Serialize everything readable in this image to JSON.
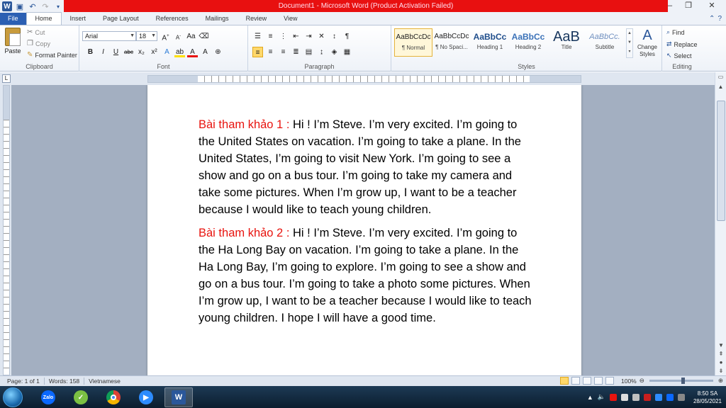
{
  "window": {
    "title": "Document1  -  Microsoft Word (Product Activation Failed)"
  },
  "ribbon_tabs": [
    "File",
    "Home",
    "Insert",
    "Page Layout",
    "References",
    "Mailings",
    "Review",
    "View"
  ],
  "clipboard": {
    "paste_label": "Paste",
    "cut_label": "Cut",
    "copy_label": "Copy",
    "format_painter_label": "Format Painter",
    "group_label": "Clipboard"
  },
  "font": {
    "name": "Arial",
    "size": "18",
    "group_label": "Font"
  },
  "paragraph": {
    "group_label": "Paragraph"
  },
  "styles": {
    "items": [
      {
        "preview": "AaBbCcDc",
        "name": "¶ Normal"
      },
      {
        "preview": "AaBbCcDc",
        "name": "¶ No Spaci..."
      },
      {
        "preview": "AaBbCc",
        "name": "Heading 1"
      },
      {
        "preview": "AaBbCc",
        "name": "Heading 2"
      },
      {
        "preview": "AaB",
        "name": "Title"
      },
      {
        "preview": "AaBbCc.",
        "name": "Subtitle"
      }
    ],
    "change_styles_label": "Change Styles",
    "group_label": "Styles"
  },
  "editing": {
    "find_label": "Find",
    "replace_label": "Replace",
    "select_label": "Select",
    "group_label": "Editing"
  },
  "document": {
    "paragraphs": [
      {
        "label": "Bài tham khảo 1 : ",
        "text": "Hi ! I’m Steve. I’m very excited. I’m going to the United States on vacation. I’m going to take a plane. In the United States, I’m going to visit New York. I’m going to see a show and go on a bus tour. I’m going to take my camera and take some pictures. When I’m grow up, I want to be a teacher because I would like to teach young children."
      },
      {
        "label": "Bài tham khảo 2 : ",
        "text": "Hi ! I’m Steve. I’m very excited. I’m going to the Ha Long Bay on vacation. I’m going to take a plane. In the Ha Long Bay, I’m going to explore. I’m going to see a show and go on a bus tour. I’m going to take a photo some pictures. When I’m grow up, I want to be a teacher because I would like to teach young children. I hope I will have a good time."
      }
    ],
    "label_color": "#e8140f"
  },
  "statusbar": {
    "page": "Page: 1 of 1",
    "words": "Words: 158",
    "language": "Vietnamese",
    "zoom": "100%"
  },
  "taskbar": {
    "apps": [
      "Zalo",
      "Chrome",
      "Zoom",
      "Word"
    ],
    "time": "8:50 SA",
    "date": "28/05/2021"
  },
  "colors": {
    "title_bar_alert": "#e81010",
    "file_tab": "#2b5fb3",
    "label_text": "#e8140f"
  }
}
